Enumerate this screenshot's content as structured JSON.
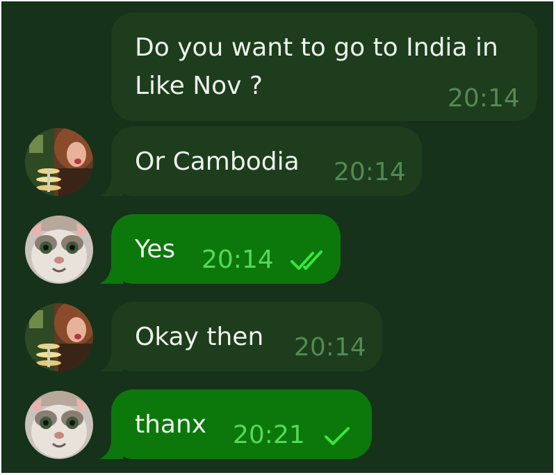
{
  "theme": {
    "background": "#16321a",
    "incoming_bubble": "#1d3d1d",
    "outgoing_bubble": "#0c780c",
    "incoming_time": "#538a52",
    "outgoing_time": "#57d957",
    "read_check": "#39e639"
  },
  "messages": [
    {
      "direction": "incoming",
      "sender_avatar": "none",
      "lines": [
        "Do you want to go to India in",
        "Like Nov ?"
      ],
      "time": "20:14"
    },
    {
      "direction": "incoming",
      "sender_avatar": "woman-photo",
      "text": "Or Cambodia",
      "time": "20:14"
    },
    {
      "direction": "outgoing",
      "sender_avatar": "cat-photo",
      "text": "Yes",
      "time": "20:14",
      "status_icon": "double-check-icon"
    },
    {
      "direction": "incoming",
      "sender_avatar": "woman-photo",
      "text": "Okay then",
      "time": "20:14"
    },
    {
      "direction": "outgoing",
      "sender_avatar": "cat-photo",
      "text": "thanx",
      "time": "20:21",
      "status_icon": "single-check-icon"
    }
  ]
}
